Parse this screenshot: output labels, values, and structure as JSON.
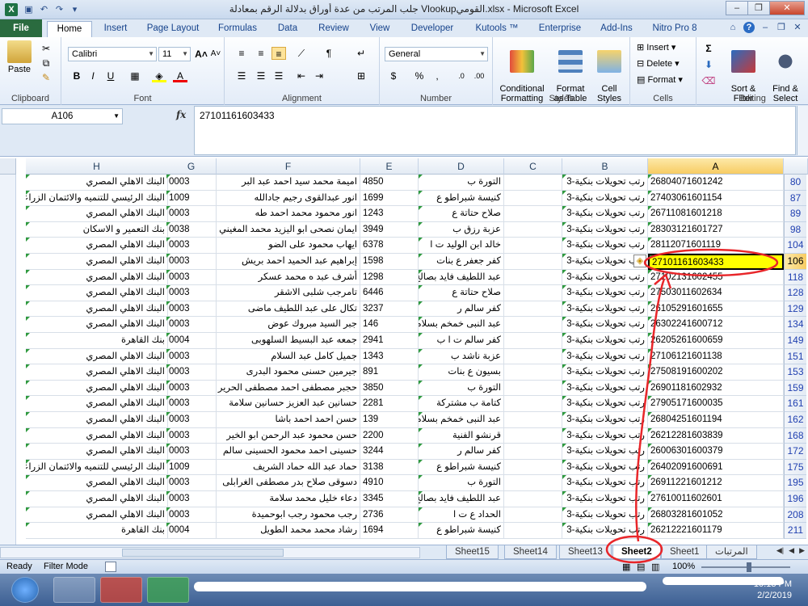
{
  "window": {
    "title": "جلب المرتب من عدة أوراق بدلالة الرقم بمعادلة Vlookupالقومي.xlsx - Microsoft Excel",
    "minimize": "–",
    "restore": "❐",
    "close": "✕"
  },
  "tabs": [
    "File",
    "Home",
    "Insert",
    "Page Layout",
    "Formulas",
    "Data",
    "Review",
    "View",
    "Developer",
    "Kutools ™",
    "Enterprise",
    "Add-Ins",
    "Nitro Pro 8"
  ],
  "ribbon": {
    "clipboard": {
      "paste": "Paste",
      "label": "Clipboard"
    },
    "font": {
      "name": "Calibri",
      "size": "11",
      "label": "Font"
    },
    "alignment": {
      "label": "Alignment"
    },
    "number": {
      "format": "General",
      "label": "Number"
    },
    "styles": {
      "conditional": "Conditional\nFormatting",
      "format_table": "Format\nas Table",
      "cell_styles": "Cell\nStyles",
      "label": "Styles"
    },
    "cells": {
      "insert": "Insert",
      "delete": "Delete",
      "format": "Format",
      "label": "Cells"
    },
    "editing": {
      "sort": "Sort &\nFilter",
      "find": "Find &\nSelect",
      "label": "Editing"
    }
  },
  "formula_bar": {
    "name_box": "A106",
    "fx": "fx",
    "content": "27101161603433"
  },
  "columns": [
    "H",
    "G",
    "F",
    "E",
    "D",
    "C",
    "B",
    "A"
  ],
  "rows": [
    {
      "num": "80",
      "A": "26804071601242",
      "B": "رتب تحويلات بنكية-3",
      "D": "التورة   ب",
      "E": "4850",
      "F": "اميمة محمد سيد احمد عبد البر",
      "G": "0003",
      "H": "البنك الاهلي المصري"
    },
    {
      "num": "87",
      "A": "27403061601154",
      "B": "رتب تحويلات بنكية-3",
      "D": "كنيسة شبراطو   ع",
      "E": "1699",
      "F": "انور عبدالقوى رجيم جادالله",
      "G": "1009",
      "H": "البنك الرئيسي للتنميه والائتمان الزراعي"
    },
    {
      "num": "89",
      "A": "26711081601218",
      "B": "رتب تحويلات بنكية-3",
      "D": "صلاح حتاتة   ع",
      "E": "1243",
      "F": "انور محمود محمد احمد طه",
      "G": "0003",
      "H": "البنك الاهلي المصري"
    },
    {
      "num": "98",
      "A": "28303121601727",
      "B": "رتب تحويلات بنكية-3",
      "D": "عزبة رزق   ب",
      "E": "3949",
      "F": "ايمان نصحى ابو اليزيد محمد المغيني",
      "G": "0038",
      "H": "بنك التعمير و الاسكان"
    },
    {
      "num": "104",
      "A": "28112071601119",
      "B": "رتب تحويلات بنكية-3",
      "D": "خالد ابن الوليد   ت   ا",
      "E": "6378",
      "F": "ايهاب محمود على الضو",
      "G": "0003",
      "H": "البنك الاهلي المصري"
    },
    {
      "num": "106",
      "A": "27101161603433",
      "B": "رتب تحويلات بنكية-3",
      "D": "كفر جعفر   ع   بنات",
      "E": "1598",
      "F": "إبراهيم عبد الحميد احمد بريش",
      "G": "0003",
      "H": "البنك الاهلي المصري"
    },
    {
      "num": "118",
      "A": "27102131602455",
      "B": "رتب تحويلات بنكية-3",
      "D": "عبد اللطيف فايد بصالح",
      "E": "1298",
      "F": "أشرف عبد ه محمد عسكر",
      "G": "0003",
      "H": "البنك الاهلي المصري"
    },
    {
      "num": "128",
      "A": "27503011602634",
      "B": "رتب تحويلات بنكية-3",
      "D": "صلاح حتاتة   ع",
      "E": "6446",
      "F": "تامرجب شلبى الاشقر",
      "G": "0003",
      "H": "البنك الاهلي المصري"
    },
    {
      "num": "129",
      "A": "26105291601655",
      "B": "رتب تحويلات بنكية-3",
      "D": "كفر سالم   ر",
      "E": "3237",
      "F": "تكال على عبد اللطيف ماضى",
      "G": "0003",
      "H": "البنك الاهلي المصري"
    },
    {
      "num": "134",
      "A": "26302241600712",
      "B": "رتب تحويلات بنكية-3",
      "D": "عبد النبى خمخم بسلام",
      "E": "146",
      "F": "جبر السيد مبروك عوض",
      "G": "0003",
      "H": "البنك الاهلي المصري"
    },
    {
      "num": "149",
      "A": "26205261600659",
      "B": "رتب تحويلات بنكية-3",
      "D": "كفر سالم   ت   ا   ب",
      "E": "2941",
      "F": "جمعه عبد البسيط السلهوبى",
      "G": "0004",
      "H": "بنك القاهرة"
    },
    {
      "num": "151",
      "A": "27106121601138",
      "B": "رتب تحويلات بنكية-3",
      "D": "عزبة ناشد   ب",
      "E": "1343",
      "F": "جميل كامل عبد السلام",
      "G": "0003",
      "H": "البنك الاهلي المصري"
    },
    {
      "num": "153",
      "A": "27508191600202",
      "B": "رتب تحويلات بنكية-3",
      "D": "بسيون   ع بنات",
      "E": "891",
      "F": "جيرمين حسنى محمود البدرى",
      "G": "0003",
      "H": "البنك الاهلي المصري"
    },
    {
      "num": "159",
      "A": "26901181602932",
      "B": "رتب تحويلات بنكية-3",
      "D": "التورة   ب",
      "E": "3850",
      "F": "حجبر مصطفى احمد مصطفى الحرير",
      "G": "0003",
      "H": "البنك الاهلي المصري"
    },
    {
      "num": "161",
      "A": "27905171600035",
      "B": "رتب تحويلات بنكية-3",
      "D": "كتامة ب مشتركة",
      "E": "2281",
      "F": "حسانين عبد العزيز حسانين سلامة",
      "G": "0003",
      "H": "البنك الاهلي المصري"
    },
    {
      "num": "162",
      "A": "26804251601194",
      "B": "رتب تحويلات بنكية-3",
      "D": "عبد النبى خمخم بسلام",
      "E": "139",
      "F": "حسن احمد احمد باشا",
      "G": "0003",
      "H": "البنك الاهلي المصري"
    },
    {
      "num": "168",
      "A": "26212281603839",
      "B": "رتب تحويلات بنكية-3",
      "D": "قرنشو الفنية",
      "E": "2200",
      "F": "حسن محمود عبد الرحمن ابو الخير",
      "G": "0003",
      "H": "البنك الاهلي المصري"
    },
    {
      "num": "172",
      "A": "26006301600379",
      "B": "رتب تحويلات بنكية-3",
      "D": "كفر سالم   ر",
      "E": "3244",
      "F": "حسينى احمد محمود الحسينى سالم",
      "G": "0003",
      "H": "البنك الاهلي المصري"
    },
    {
      "num": "175",
      "A": "26402091600691",
      "B": "رتب تحويلات بنكية-3",
      "D": "كنيسة شبراطو   ع",
      "E": "3138",
      "F": "حماد عبد الله حماد الشريف",
      "G": "1009",
      "H": "البنك الرئيسي للتنميه والائتمان الزراعي"
    },
    {
      "num": "195",
      "A": "26911221601212",
      "B": "رتب تحويلات بنكية-3",
      "D": "التورة   ب",
      "E": "4910",
      "F": "دسوقى صلاح بدر مصطفى الغرابلى",
      "G": "0003",
      "H": "البنك الاهلي المصري"
    },
    {
      "num": "196",
      "A": "27610011602601",
      "B": "رتب تحويلات بنكية-3",
      "D": "عبد اللطيف فايد بصالح",
      "E": "3345",
      "F": "دعاء خليل محمد سلامة",
      "G": "0003",
      "H": "البنك الاهلي المصري"
    },
    {
      "num": "208",
      "A": "26803281601052",
      "B": "رتب تحويلات بنكية-3",
      "D": "الحداد   ع   ت   ا",
      "E": "2736",
      "F": "رجب محمود رجب ابوحميدة",
      "G": "0003",
      "H": "البنك الاهلي المصري"
    },
    {
      "num": "211",
      "A": "26212221601179",
      "B": "رتب تحويلات بنكية-3",
      "D": "كنيسة شبراطو   ع",
      "E": "1694",
      "F": "رشاد محمد محمد الطويل",
      "G": "0004",
      "H": "بنك القاهرة"
    }
  ],
  "sheet_tabs": [
    "Sheet15",
    "Sheet14",
    "Sheet13",
    "Sheet2",
    "Sheet1",
    "المرتبات"
  ],
  "active_sheet": "Sheet2",
  "status": {
    "ready": "Ready",
    "filter": "Filter Mode",
    "zoom": "100%"
  },
  "taskbar": {
    "time": "10:13 PM",
    "date": "2/2/2019"
  },
  "colors": {
    "excel_green": "#1e7145",
    "selection": "#ffff00",
    "annotation": "#e8262a"
  }
}
